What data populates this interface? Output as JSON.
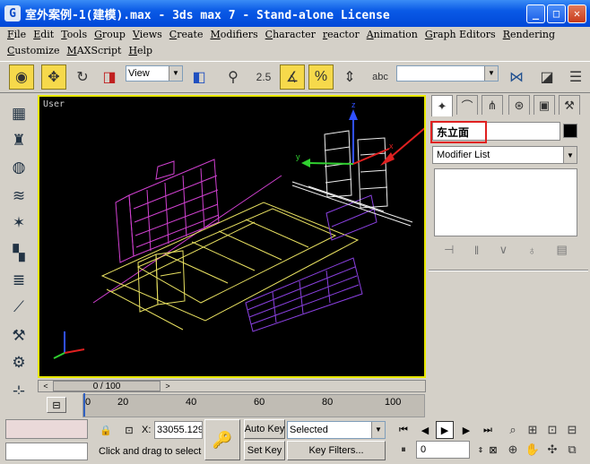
{
  "window": {
    "title": "室外案例-1(建模).max - 3ds max 7  - Stand-alone License",
    "minimize": "_",
    "maximize": "□",
    "close": "✕"
  },
  "menu": {
    "row1": [
      "File",
      "Edit",
      "Tools",
      "Group",
      "Views",
      "Create",
      "Modifiers",
      "Character",
      "reactor",
      "Animation",
      "Graph Editors",
      "Rendering"
    ],
    "row2": [
      "Customize",
      "MAXScript",
      "Help"
    ]
  },
  "toolbar": {
    "view_dropdown": "View",
    "spinner_snap": "2.5",
    "percent_snap": "%",
    "named_selection": ""
  },
  "viewport": {
    "label": "User",
    "axis_x": "x",
    "axis_y": "y",
    "axis_z": "z"
  },
  "command_panel": {
    "object_name": "东立面",
    "modifier_list": "Modifier List"
  },
  "time_slider": {
    "position": "0 / 100",
    "prev": "<",
    "next": ">",
    "current_frame": 0,
    "total_frames": 100
  },
  "trackbar": {
    "labels": [
      "20",
      "40",
      "60",
      "80",
      "100"
    ],
    "first_label": "0"
  },
  "status": {
    "x_label": "X:",
    "x_value": "33055.129",
    "auto_key": "Auto Key",
    "set_key": "Set Key",
    "key_mode": "Selected",
    "key_filters": "Key Filters...",
    "frame": "0",
    "prompt": "Click and drag to select"
  },
  "colors": {
    "title_bar": "#0a5ae6",
    "viewport_border": "#e8e800",
    "annotation_red": "#e02020",
    "wire_magenta": "#d040d0",
    "wire_yellow": "#e8e060",
    "wire_purple": "#8a40e0"
  }
}
